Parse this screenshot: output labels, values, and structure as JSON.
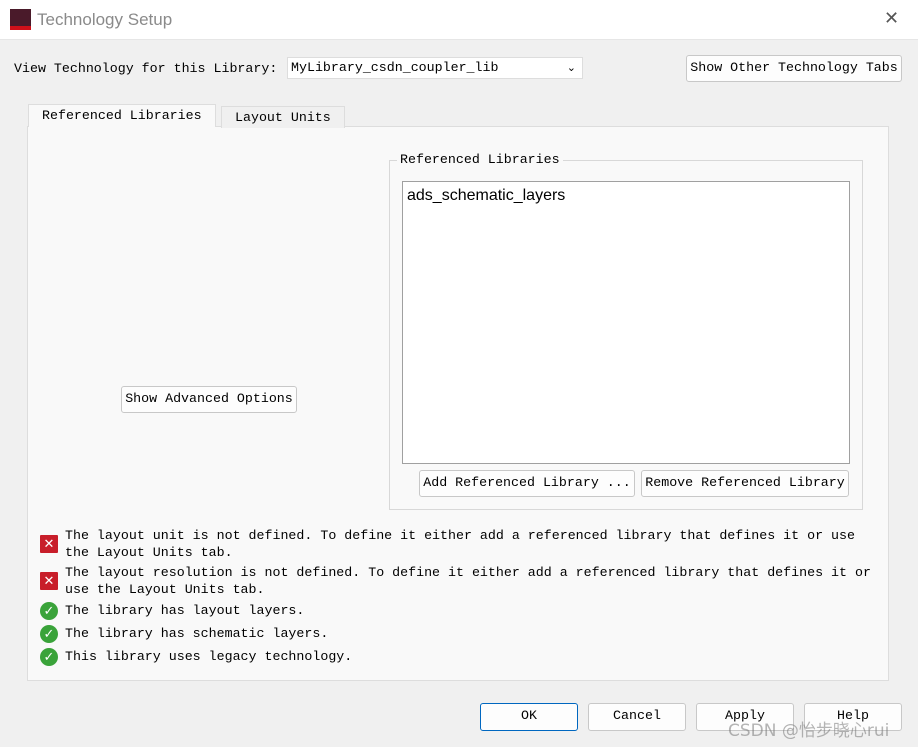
{
  "window": {
    "title": "Technology Setup",
    "icon": "app-logo-icon",
    "close_icon": "close-icon"
  },
  "header": {
    "library_label": "View Technology for this Library:",
    "library_value": "MyLibrary_csdn_coupler_lib",
    "show_other_tabs": "Show Other Technology Tabs"
  },
  "tabs": [
    {
      "label": "Referenced Libraries",
      "active": true
    },
    {
      "label": "Layout Units",
      "active": false
    }
  ],
  "main": {
    "show_advanced": "Show Advanced Options",
    "group_title": "Referenced Libraries",
    "libraries": [
      "ads_schematic_layers"
    ],
    "add_button": "Add Referenced Library ...",
    "remove_button": "Remove Referenced Library"
  },
  "messages": [
    {
      "status": "error",
      "line1": "The layout unit is not defined. To define it either add a referenced library that defines it or use",
      "line2": "the Layout Units tab."
    },
    {
      "status": "error",
      "line1": "The layout resolution is not defined. To define it either add a referenced library that defines it or",
      "line2": "use the Layout Units tab."
    },
    {
      "status": "ok",
      "line1": "The library has layout layers."
    },
    {
      "status": "ok",
      "line1": "The library has schematic layers."
    },
    {
      "status": "ok",
      "line1": "This library uses legacy technology."
    }
  ],
  "footer": {
    "ok": "OK",
    "cancel": "Cancel",
    "apply": "Apply",
    "help": "Help"
  },
  "watermark": "CSDN @怡步晓心rui",
  "colors": {
    "error": "#c81e2a",
    "ok": "#3aa33a",
    "focus": "#0067c0"
  }
}
